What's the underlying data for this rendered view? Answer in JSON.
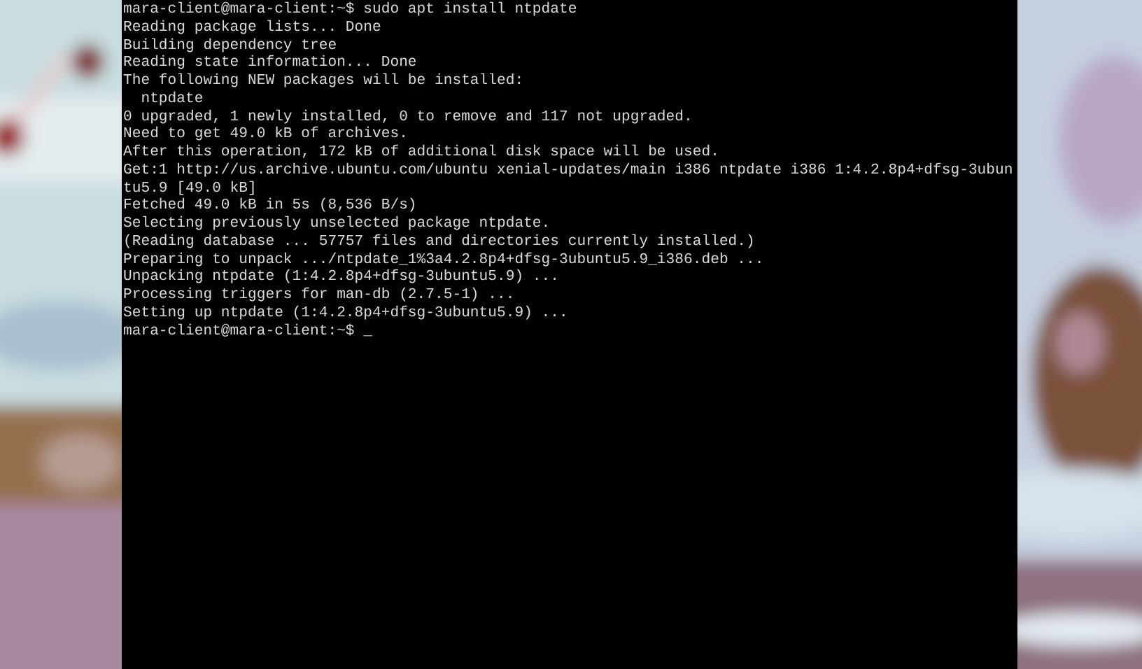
{
  "terminal": {
    "lines": [
      "mara-client@mara-client:~$ sudo apt install ntpdate",
      "Reading package lists... Done",
      "Building dependency tree",
      "Reading state information... Done",
      "The following NEW packages will be installed:",
      "  ntpdate",
      "0 upgraded, 1 newly installed, 0 to remove and 117 not upgraded.",
      "Need to get 49.0 kB of archives.",
      "After this operation, 172 kB of additional disk space will be used.",
      "Get:1 http://us.archive.ubuntu.com/ubuntu xenial-updates/main i386 ntpdate i386 1:4.2.8p4+dfsg-3ubun",
      "tu5.9 [49.0 kB]",
      "Fetched 49.0 kB in 5s (8,536 B/s)",
      "Selecting previously unselected package ntpdate.",
      "(Reading database ... 57757 files and directories currently installed.)",
      "Preparing to unpack .../ntpdate_1%3a4.2.8p4+dfsg-3ubuntu5.9_i386.deb ...",
      "Unpacking ntpdate (1:4.2.8p4+dfsg-3ubuntu5.9) ...",
      "Processing triggers for man-db (2.7.5-1) ...",
      "Setting up ntpdate (1:4.2.8p4+dfsg-3ubuntu5.9) ...",
      "mara-client@mara-client:~$ _"
    ]
  }
}
